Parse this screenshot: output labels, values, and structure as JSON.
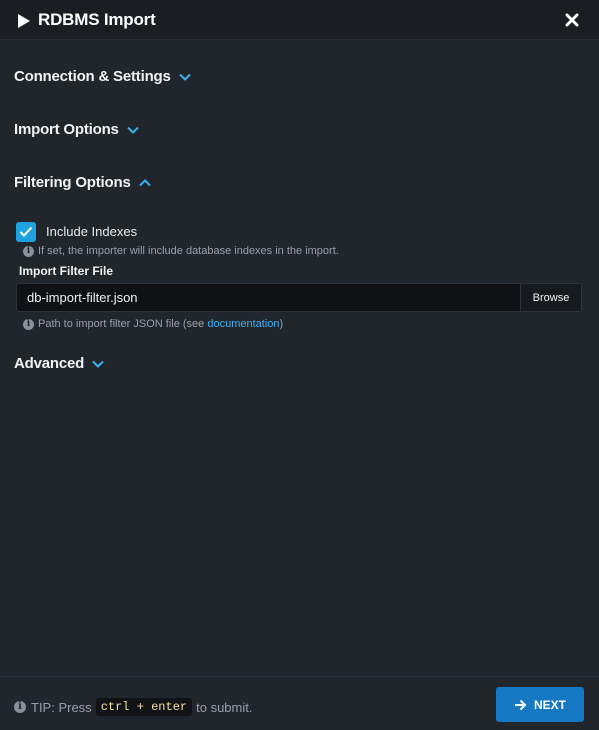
{
  "dialog": {
    "title": "RDBMS Import",
    "close_icon": "close-icon",
    "play_icon": "play-icon"
  },
  "sections": {
    "connection": {
      "label": "Connection & Settings",
      "state": "collapsed"
    },
    "import_options": {
      "label": "Import Options",
      "state": "collapsed"
    },
    "filtering": {
      "label": "Filtering Options",
      "state": "expanded"
    },
    "advanced": {
      "label": "Advanced",
      "state": "collapsed"
    }
  },
  "filtering": {
    "include_indexes": {
      "label": "Include Indexes",
      "checked": true,
      "help": "If set, the importer will include database indexes in the import."
    },
    "filter_file": {
      "label": "Import Filter File",
      "value": "db-import-filter.json",
      "placeholder": "",
      "browse_label": "Browse",
      "help_prefix": "Path to import filter JSON file (see ",
      "help_link": "documentation",
      "help_suffix": ")"
    }
  },
  "footer": {
    "tip_prefix": "TIP: Press",
    "shortcut": "ctrl + enter",
    "tip_suffix": "to submit.",
    "next_label": "NEXT"
  },
  "colors": {
    "background": "#21252c",
    "header": "#1a1d22",
    "accent": "#1ea3e0",
    "primary_button": "#1678c2",
    "link": "#3bb4f2"
  }
}
